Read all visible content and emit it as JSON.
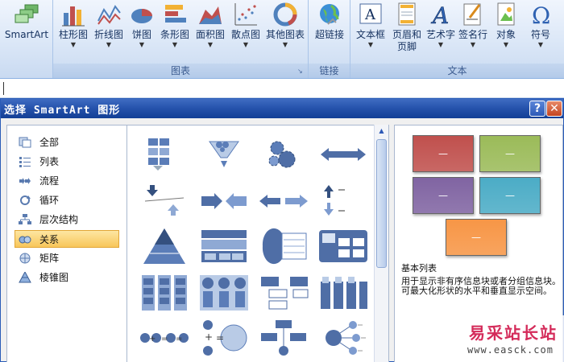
{
  "ribbon": {
    "smartart": {
      "label": "SmartArt"
    },
    "charts": {
      "group_label": "图表",
      "buttons": [
        {
          "label": "柱形图",
          "icon": "column-chart-icon"
        },
        {
          "label": "折线图",
          "icon": "line-chart-icon"
        },
        {
          "label": "饼图",
          "icon": "pie-chart-icon"
        },
        {
          "label": "条形图",
          "icon": "bar-chart-icon"
        },
        {
          "label": "面积图",
          "icon": "area-chart-icon"
        },
        {
          "label": "散点图",
          "icon": "scatter-chart-icon"
        },
        {
          "label": "其他图表",
          "icon": "other-charts-icon"
        }
      ]
    },
    "links": {
      "group_label": "链接",
      "hyperlink": "超链接"
    },
    "text": {
      "group_label": "文本",
      "textbox": "文本框",
      "header_footer_1": "页眉和",
      "header_footer_2": "页脚",
      "wordart": "艺术字",
      "signature": "签名行",
      "object": "对象",
      "symbol": "符号"
    }
  },
  "dialog": {
    "title": "选择 SmartArt 图形",
    "help": "?",
    "close": "✕",
    "categories": [
      {
        "label": "全部",
        "icon": "all-icon"
      },
      {
        "label": "列表",
        "icon": "list-icon"
      },
      {
        "label": "流程",
        "icon": "process-icon"
      },
      {
        "label": "循环",
        "icon": "cycle-icon"
      },
      {
        "label": "层次结构",
        "icon": "hierarchy-icon"
      },
      {
        "label": "关系",
        "icon": "relationship-icon",
        "selected": true
      },
      {
        "label": "矩阵",
        "icon": "matrix-icon"
      },
      {
        "label": "棱锥图",
        "icon": "pyramid-icon"
      }
    ],
    "preview": {
      "box_label": "—",
      "title": "基本列表",
      "description": "用于显示非有序信息块或者分组信息块。可最大化形状的水平和垂直显示空间。",
      "colors": [
        "#c0504d",
        "#9bbb59",
        "#8064a2",
        "#4bacc6",
        "#f79646"
      ]
    }
  },
  "watermark": {
    "cn": "易采站长站",
    "url": "www.easck.com"
  }
}
